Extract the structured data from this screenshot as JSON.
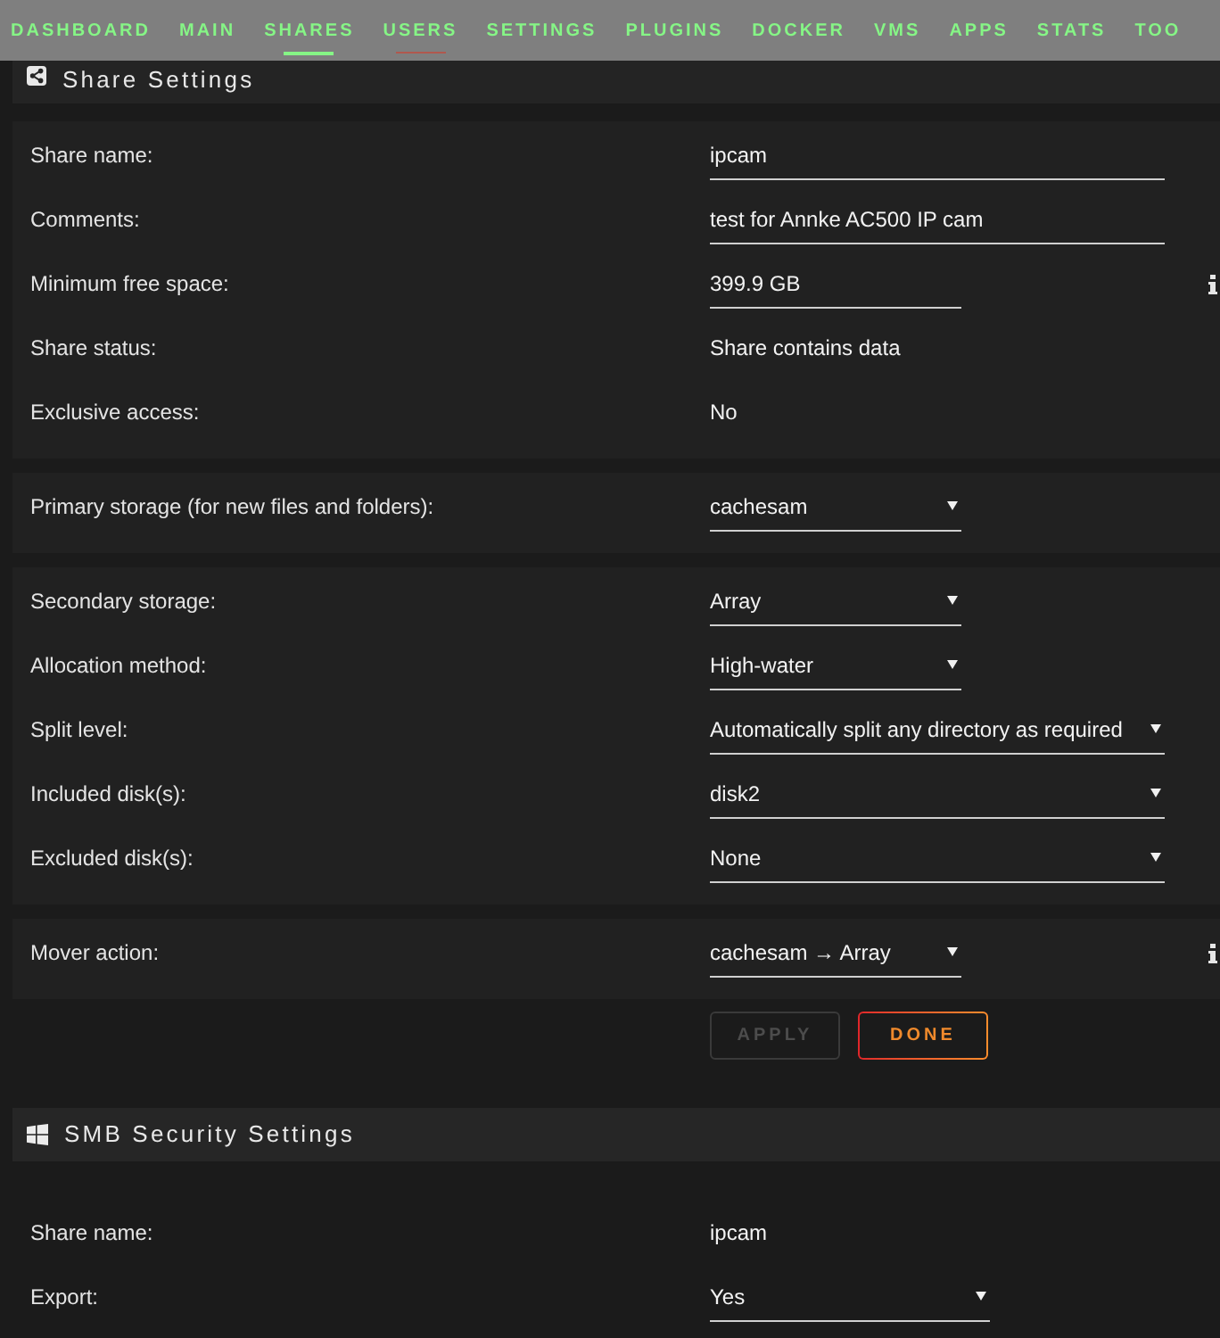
{
  "nav": {
    "tabs": [
      {
        "label": "DASHBOARD",
        "selected": false,
        "hovered": false
      },
      {
        "label": "MAIN",
        "selected": false,
        "hovered": false
      },
      {
        "label": "SHARES",
        "selected": true,
        "hovered": false
      },
      {
        "label": "USERS",
        "selected": false,
        "hovered": true
      },
      {
        "label": "SETTINGS",
        "selected": false,
        "hovered": false
      },
      {
        "label": "PLUGINS",
        "selected": false,
        "hovered": false
      },
      {
        "label": "DOCKER",
        "selected": false,
        "hovered": false
      },
      {
        "label": "VMS",
        "selected": false,
        "hovered": false
      },
      {
        "label": "APPS",
        "selected": false,
        "hovered": false
      },
      {
        "label": "STATS",
        "selected": false,
        "hovered": false
      },
      {
        "label": "TOO",
        "selected": false,
        "hovered": false
      }
    ]
  },
  "share_settings": {
    "title": "Share Settings",
    "panels": [
      {
        "rows": [
          {
            "label": "Share name:",
            "kind": "input",
            "value": "ipcam",
            "help": false
          },
          {
            "label": "Comments:",
            "kind": "input",
            "value": "test for Annke AC500 IP cam",
            "help": false
          },
          {
            "label": "Minimum free space:",
            "kind": "shortinput",
            "value": "399.9 GB",
            "help": true
          },
          {
            "label": "Share status:",
            "kind": "text",
            "value": "Share contains data",
            "help": false
          },
          {
            "label": "Exclusive access:",
            "kind": "text",
            "value": "No",
            "help": false
          }
        ]
      },
      {
        "rows": [
          {
            "label": "Primary storage (for new files and folders):",
            "kind": "shortselect",
            "value": "cachesam",
            "help": false
          }
        ]
      },
      {
        "rows": [
          {
            "label": "Secondary storage:",
            "kind": "shortselect",
            "value": "Array",
            "help": false
          },
          {
            "label": "Allocation method:",
            "kind": "shortselect",
            "value": "High-water",
            "help": false
          },
          {
            "label": "Split level:",
            "kind": "select",
            "value": "Automatically split any directory as required",
            "help": false
          },
          {
            "label": "Included disk(s):",
            "kind": "select",
            "value": "disk2",
            "help": false
          },
          {
            "label": "Excluded disk(s):",
            "kind": "select",
            "value": "None",
            "help": false
          }
        ]
      },
      {
        "rows": [
          {
            "label": "Mover action:",
            "kind": "shortselect",
            "value": "cachesam → Array",
            "help": true
          }
        ]
      }
    ],
    "buttons": [
      {
        "label": "APPLY",
        "disabled": true
      },
      {
        "label": "DONE",
        "disabled": false
      }
    ]
  },
  "smb_security_settings": {
    "title": "SMB Security Settings",
    "rows": [
      {
        "label": "Share name:",
        "kind": "text",
        "value": "ipcam",
        "help": false
      },
      {
        "label": "Export:",
        "kind": "mediumselect",
        "value": "Yes",
        "help": false
      }
    ]
  }
}
